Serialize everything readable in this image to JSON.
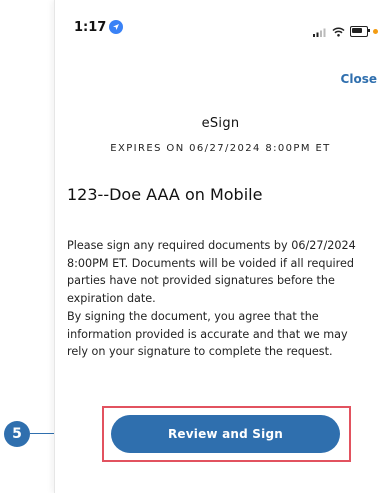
{
  "status_bar": {
    "time": "1:17",
    "icons": [
      "location-icon",
      "signal-icon",
      "wifi-icon",
      "battery-icon"
    ]
  },
  "header": {
    "close_label": "Close"
  },
  "content": {
    "title": "eSign",
    "expires": "EXPIRES ON 06/27/2024 8:00PM ET",
    "document_name": "123--Doe AAA on Mobile",
    "paragraphs": [
      "Please sign any required documents by 06/27/2024 8:00PM ET. Documents will be voided if all required parties have not provided signatures before the expiration date.",
      "By signing the document, you agree that the information provided is accurate and that we may rely on your signature to complete the request."
    ]
  },
  "actions": {
    "review_sign_label": "Review and Sign"
  },
  "annotation": {
    "step_number": "5"
  },
  "colors": {
    "accent": "#2f6fae",
    "highlight": "#e2525f",
    "location": "#3a82f6"
  }
}
